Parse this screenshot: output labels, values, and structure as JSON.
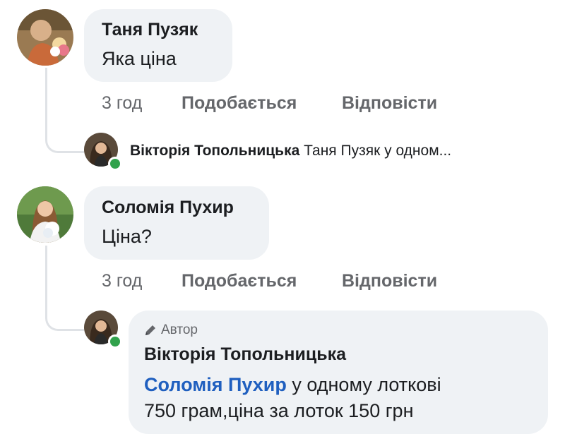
{
  "comments": [
    {
      "author": "Таня Пузяк",
      "text": "Яка ціна",
      "time": "3 год",
      "like_label": "Подобається",
      "reply_label": "Відповісти",
      "reply_preview": {
        "author": "Вікторія Топольницька",
        "text": "Таня Пузяк у одном..."
      }
    },
    {
      "author": "Соломія Пухир",
      "text": "Ціна?",
      "time": "3 год",
      "like_label": "Подобається",
      "reply_label": "Відповісти",
      "reply": {
        "badge": "Автор",
        "author": "Вікторія Топольницька",
        "mention": "Соломія Пухир",
        "text_after_mention": " у одному лоткові",
        "text_line2": "750 грам,ціна за лоток 150 грн"
      }
    }
  ],
  "colors": {
    "bubble": "#eff2f5",
    "secondary_text": "#65676b",
    "mention": "#1f5fbf",
    "online": "#31a24c"
  }
}
